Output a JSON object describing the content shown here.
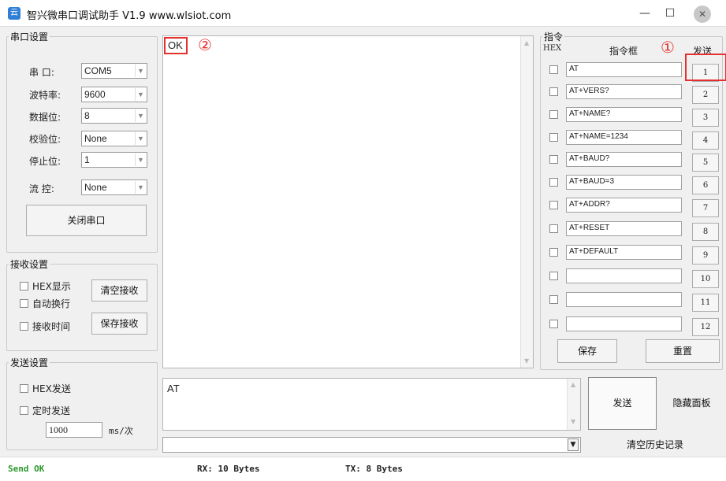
{
  "window": {
    "title": "智兴微串口调试助手 V1.9 www.wlsiot.com",
    "icon_text": "云",
    "minimize": "—",
    "maximize": "☐",
    "close": "✕"
  },
  "serial_settings": {
    "legend": "串口设置",
    "port_label": "串 口:",
    "port_value": "COM5",
    "baud_label": "波特率:",
    "baud_value": "9600",
    "databits_label": "数据位:",
    "databits_value": "8",
    "parity_label": "校验位:",
    "parity_value": "None",
    "stopbits_label": "停止位:",
    "stopbits_value": "1",
    "flow_label": "流 控:",
    "flow_value": "None",
    "close_port_button": "关闭串口"
  },
  "receive_settings": {
    "legend": "接收设置",
    "hex_display": "HEX显示",
    "auto_wrap": "自动换行",
    "recv_time": "接收时间",
    "clear_button": "清空接收",
    "save_button": "保存接收"
  },
  "send_settings": {
    "legend": "发送设置",
    "hex_send": "HEX发送",
    "timed_send": "定时发送",
    "interval_value": "1000",
    "interval_unit": "ms/次"
  },
  "receive_area": {
    "text": "OK",
    "annotation": "②"
  },
  "command_panel": {
    "legend": "指令",
    "hex_header": "HEX",
    "box_header": "指令框",
    "send_header": "发送",
    "annotation": "①",
    "commands": [
      {
        "text": "AT",
        "button": "1"
      },
      {
        "text": "AT+VERS?",
        "button": "2"
      },
      {
        "text": "AT+NAME?",
        "button": "3"
      },
      {
        "text": "AT+NAME=1234",
        "button": "4"
      },
      {
        "text": "AT+BAUD?",
        "button": "5"
      },
      {
        "text": "AT+BAUD=3",
        "button": "6"
      },
      {
        "text": "AT+ADDR?",
        "button": "7"
      },
      {
        "text": "AT+RESET",
        "button": "8"
      },
      {
        "text": "AT+DEFAULT",
        "button": "9"
      },
      {
        "text": "",
        "button": "10"
      },
      {
        "text": "",
        "button": "11"
      },
      {
        "text": "",
        "button": "12"
      }
    ],
    "save_button": "保存",
    "reset_button": "重置"
  },
  "send_area": {
    "text": "AT",
    "send_button": "发送",
    "hide_panel_button": "隐藏面板",
    "clear_history_button": "清空历史记录"
  },
  "status": {
    "send_status": "Send OK",
    "rx": "RX: 10 Bytes",
    "tx": "TX: 8 Bytes"
  },
  "colors": {
    "status_ok": "#2a9a2a",
    "annotation": "#e53030"
  }
}
